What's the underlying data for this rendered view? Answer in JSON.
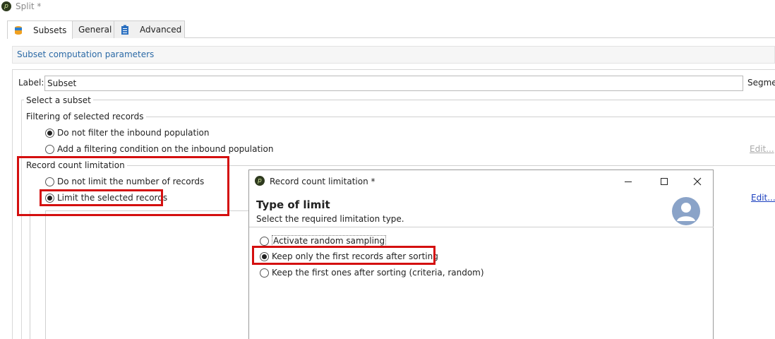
{
  "window": {
    "title": "Split *"
  },
  "tabs": [
    {
      "label": "Subsets",
      "icon": "database-icon",
      "active": true
    },
    {
      "label": "General",
      "active": false
    },
    {
      "label": "Advanced",
      "icon": "clipboard-icon",
      "active": false
    }
  ],
  "section": {
    "title": "Subset computation parameters"
  },
  "label_field": {
    "label": "Label:",
    "value": "Subset",
    "right_label": "Segmen"
  },
  "select_subset": {
    "title": "Select a subset"
  },
  "filtering": {
    "title": "Filtering of selected records",
    "options": [
      {
        "label": "Do not filter the inbound population",
        "selected": true
      },
      {
        "label": "Add a filtering condition on the inbound population",
        "selected": false
      }
    ],
    "edit_link": "Edit..."
  },
  "record_count": {
    "title": "Record count limitation",
    "options": [
      {
        "label": "Do not limit the number of records",
        "selected": false
      },
      {
        "label": "Limit the selected records",
        "selected": true
      }
    ],
    "edit_link": "Edit..."
  },
  "dialog": {
    "title": "Record count limitation *",
    "heading": "Type of limit",
    "subtitle": "Select the required limitation type.",
    "options": [
      {
        "label": "Activate random sampling",
        "selected": false
      },
      {
        "label": "Keep only the first records after sorting",
        "selected": true
      },
      {
        "label": "Keep the first ones after sorting (criteria, random)",
        "selected": false
      }
    ]
  },
  "colors": {
    "highlight": "#d40f0f",
    "link": "#1a3fbf",
    "section_title": "#2c6aa6",
    "avatar": "#8aa3c8"
  }
}
